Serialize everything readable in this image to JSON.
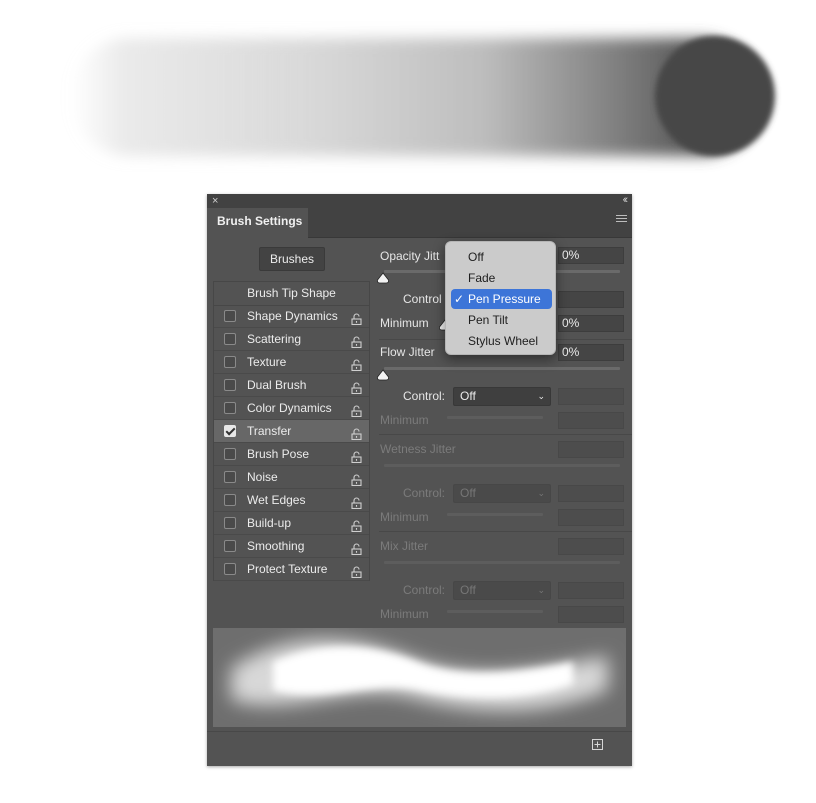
{
  "panel": {
    "title": "Brush Settings",
    "close_glyph": "×",
    "collapse_glyph": "‹‹",
    "menu_icon": "hamburger-menu-icon",
    "brushes_button": "Brushes",
    "brush_tip_shape": "Brush Tip Shape",
    "options": [
      {
        "label": "Shape Dynamics",
        "checked": false
      },
      {
        "label": "Scattering",
        "checked": false
      },
      {
        "label": "Texture",
        "checked": false
      },
      {
        "label": "Dual Brush",
        "checked": false
      },
      {
        "label": "Color Dynamics",
        "checked": false
      },
      {
        "label": "Transfer",
        "checked": true,
        "selected": true
      },
      {
        "label": "Brush Pose",
        "checked": false
      },
      {
        "label": "Noise",
        "checked": false
      },
      {
        "label": "Wet Edges",
        "checked": false
      },
      {
        "label": "Build-up",
        "checked": false
      },
      {
        "label": "Smoothing",
        "checked": false
      },
      {
        "label": "Protect Texture",
        "checked": false
      }
    ]
  },
  "transfer": {
    "opacity_jitter": {
      "label": "Opacity Jitt",
      "value": "0%"
    },
    "opacity_control": {
      "label": "Control"
    },
    "opacity_minimum": {
      "label": "Minimum",
      "value": "0%"
    },
    "flow_jitter": {
      "label": "Flow Jitter",
      "value": "0%"
    },
    "flow_control": {
      "label": "Control:",
      "value": "Off"
    },
    "flow_minimum": {
      "label": "Minimum"
    },
    "wetness_jitter": {
      "label": "Wetness Jitter"
    },
    "wetness_control": {
      "label": "Control:",
      "value": "Off"
    },
    "wetness_minimum": {
      "label": "Minimum"
    },
    "mix_jitter": {
      "label": "Mix Jitter"
    },
    "mix_control": {
      "label": "Control:",
      "value": "Off"
    },
    "mix_minimum": {
      "label": "Minimum"
    }
  },
  "dropdown": {
    "items": [
      "Off",
      "Fade",
      "Pen Pressure",
      "Pen Tilt",
      "Stylus Wheel"
    ],
    "selected": "Pen Pressure",
    "check_glyph": "✓"
  },
  "icons": {
    "lock": "lock-icon",
    "new_preset": "new-preset-icon",
    "chevron": "chevron-down-icon"
  },
  "colors": {
    "panel_bg": "#535353",
    "selection_blue": "#3d75d8",
    "menu_bg": "#cbcbcb"
  }
}
